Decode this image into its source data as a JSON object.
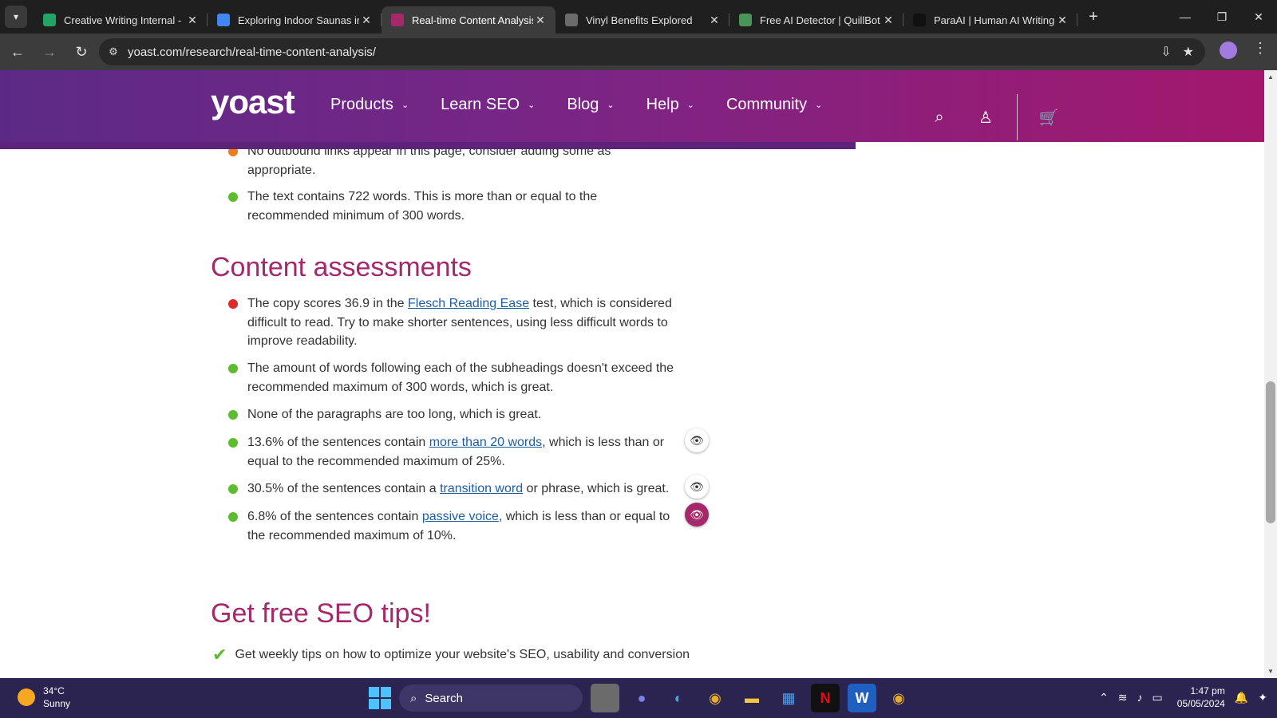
{
  "browser": {
    "tabs": [
      {
        "title": "Creative Writing Internal -",
        "favicon": "sheets-icon",
        "color": "#21a464"
      },
      {
        "title": "Exploring Indoor Saunas in",
        "favicon": "docs-icon",
        "color": "#4285f4"
      },
      {
        "title": "Real-time Content Analysis",
        "favicon": "yoast-icon",
        "color": "#a4286a",
        "active": true
      },
      {
        "title": "Vinyl Benefits Explored",
        "favicon": "chatgpt-icon",
        "color": "#6b6b6b"
      },
      {
        "title": "Free AI Detector | QuillBot",
        "favicon": "quillbot-icon",
        "color": "#499557"
      },
      {
        "title": "ParaAI | Human AI Writing",
        "favicon": "para-icon",
        "color": "#111111"
      }
    ],
    "url": "yoast.com/research/real-time-content-analysis/"
  },
  "header": {
    "logo": "yoast",
    "nav": [
      "Products",
      "Learn SEO",
      "Blog",
      "Help",
      "Community"
    ]
  },
  "content": {
    "top_items": [
      {
        "status": "orange",
        "text": "No outbound links appear in this page, consider adding some as appropriate."
      },
      {
        "status": "green",
        "text": "The text contains 722 words. This is more than or equal to the recommended minimum of 300 words."
      }
    ],
    "content_heading": "Content assessments",
    "assessments": [
      {
        "status": "red",
        "pre": "The copy scores 36.9 in the ",
        "link": "Flesch Reading Ease",
        "post": " test, which is considered difficult to read. Try to make shorter sentences, using less difficult words to improve readability."
      },
      {
        "status": "green",
        "pre": "The amount of words following each of the subheadings doesn't exceed the recommended maximum of 300 words, which is great.",
        "link": "",
        "post": ""
      },
      {
        "status": "green",
        "pre": "None of the paragraphs are too long, which is great.",
        "link": "",
        "post": ""
      },
      {
        "status": "green",
        "pre": "13.6% of the sentences contain ",
        "link": "more than 20 words",
        "post": ", which is less than or equal to the recommended maximum of 25%."
      },
      {
        "status": "green",
        "pre": "30.5% of the sentences contain a ",
        "link": "transition word",
        "post": " or phrase, which is great."
      },
      {
        "status": "green",
        "pre": "6.8% of the sentences contain ",
        "link": "passive voice",
        "post": ", which is less than or equal to the recommended maximum of 10%."
      }
    ],
    "tips_heading": "Get free SEO tips!",
    "tips_item": "Get weekly tips on how to optimize your website's SEO, usability and conversion"
  },
  "taskbar": {
    "temperature": "34°C",
    "weather": "Sunny",
    "search_placeholder": "Search",
    "time": "1:47 pm",
    "date": "05/05/2024"
  },
  "colors": {
    "accent": "#a4286a",
    "status_green": "#5bbd2c",
    "status_red": "#dc2b2b",
    "status_orange": "#ee7c1b"
  }
}
